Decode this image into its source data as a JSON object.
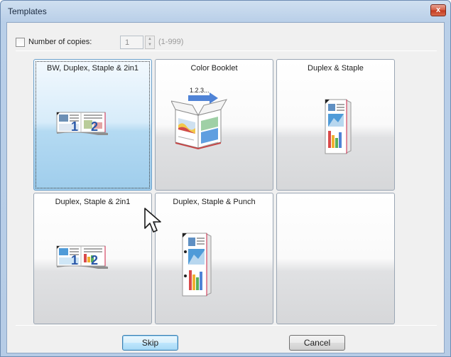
{
  "window": {
    "title": "Templates",
    "close_glyph": "x"
  },
  "copies": {
    "checkbox_checked": false,
    "label": "Number of copies:",
    "value": "1",
    "range": "(1-999)"
  },
  "tiles": [
    {
      "label": "BW, Duplex, Staple & 2in1",
      "selected": true,
      "icon": "booklet-2in1-icon"
    },
    {
      "label": "Color Booklet",
      "selected": false,
      "icon": "color-booklet-icon"
    },
    {
      "label": "Duplex & Staple",
      "selected": false,
      "icon": "duplex-staple-icon"
    },
    {
      "label": "Duplex, Staple & 2in1",
      "selected": false,
      "icon": "booklet-2in1-icon"
    },
    {
      "label": "Duplex, Staple & Punch",
      "selected": false,
      "icon": "duplex-staple-punch-icon"
    },
    {
      "label": "",
      "selected": false,
      "icon": ""
    }
  ],
  "art_text": {
    "page_one": "1",
    "page_two": "2",
    "booklet_order": "1.2.3..."
  },
  "buttons": {
    "skip": "Skip",
    "cancel": "Cancel"
  },
  "colors": {
    "selected_tile": "#b4daf2",
    "titlebar": "#cfdff0",
    "close_button": "#c3391e"
  }
}
